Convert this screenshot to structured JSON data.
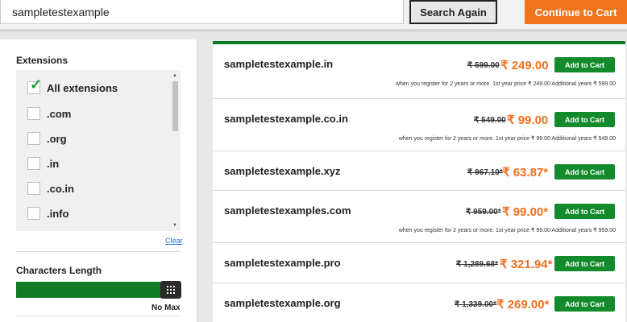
{
  "topbar": {
    "search_value": "sampletestexample",
    "search_again_label": "Search Again",
    "continue_label": "Continue to Cart"
  },
  "filters": {
    "extensions_title": "Extensions",
    "extensions": [
      {
        "label": "All extensions",
        "checked": true
      },
      {
        "label": ".com",
        "checked": false
      },
      {
        "label": ".org",
        "checked": false
      },
      {
        "label": ".in",
        "checked": false
      },
      {
        "label": ".co.in",
        "checked": false
      },
      {
        "label": ".info",
        "checked": false
      }
    ],
    "clear_label": "Clear",
    "length_title": "Characters Length",
    "length_max_label": "No Max"
  },
  "results": [
    {
      "domain": "sampletestexample.in",
      "old_price": "₹ 599.00",
      "new_price": "₹ 249.00",
      "add_label": "Add to Cart",
      "note": "when you register for 2 years or more. 1st year price ₹ 249.00 Additional years ₹ 599.00"
    },
    {
      "domain": "sampletestexample.co.in",
      "old_price": "₹ 549.00",
      "new_price": "₹ 99.00",
      "add_label": "Add to Cart",
      "note": "when you register for 2 years or more. 1st year price ₹ 99.00 Additional years ₹ 549.00"
    },
    {
      "domain": "sampletestexample.xyz",
      "old_price": "₹ 967.10*",
      "new_price": "₹ 63.87*",
      "add_label": "Add to Cart",
      "note": ""
    },
    {
      "domain": "sampletestexamples.com",
      "old_price": "₹ 959.00*",
      "new_price": "₹ 99.00*",
      "add_label": "Add to Cart",
      "note": "when you register for 2 years or more. 1st year price ₹ 99.00 Additional years ₹ 959.00"
    },
    {
      "domain": "sampletestexample.pro",
      "old_price": "₹ 1,289.68*",
      "new_price": "₹ 321.94*",
      "add_label": "Add to Cart",
      "note": ""
    },
    {
      "domain": "sampletestexample.org",
      "old_price": "₹ 1,339.00*",
      "new_price": "₹ 269.00*",
      "add_label": "Add to Cart",
      "note": ""
    }
  ],
  "colors": {
    "accent_orange": "#f0731e",
    "brand_green": "#117a27",
    "button_green": "#138b2c",
    "price_orange": "#f07020"
  }
}
